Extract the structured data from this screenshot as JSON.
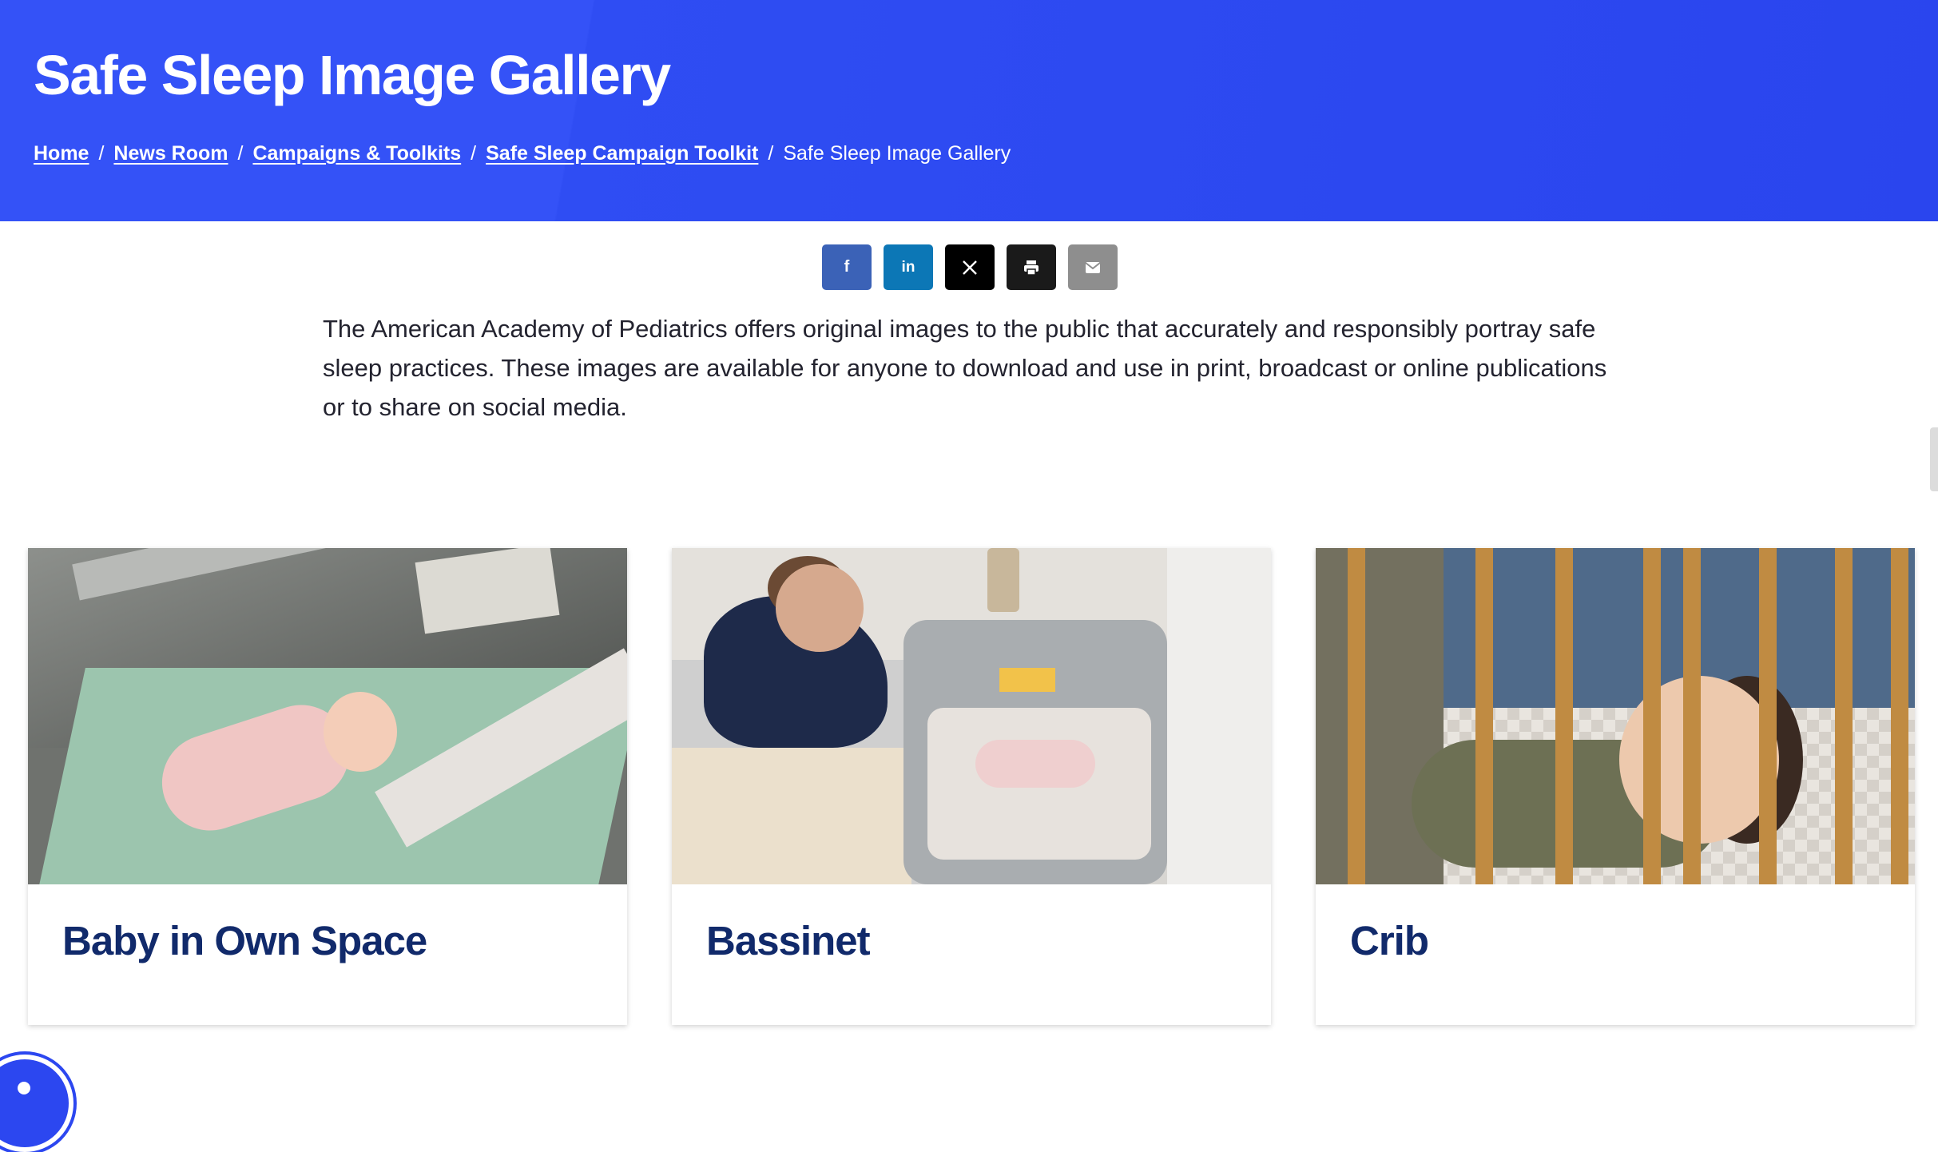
{
  "page": {
    "title": "Safe Sleep Image Gallery"
  },
  "breadcrumb": {
    "items": [
      {
        "label": "Home"
      },
      {
        "label": "News Room"
      },
      {
        "label": "Campaigns & Toolkits"
      },
      {
        "label": "Safe Sleep Campaign Toolkit"
      }
    ],
    "current": "Safe Sleep Image Gallery",
    "separator": "/"
  },
  "share": {
    "facebook": {
      "icon": "facebook-icon",
      "glyph": "f"
    },
    "linkedin": {
      "icon": "linkedin-icon",
      "glyph": "in"
    },
    "x": {
      "icon": "x-icon",
      "glyph": "𝕏"
    },
    "print": {
      "icon": "print-icon"
    },
    "email": {
      "icon": "email-icon"
    }
  },
  "intro": "The American Academy of Pediatrics offers original images to the public that accurately and responsibly portray safe sleep practices. These images are available for anyone to download and use in print, broadcast or online publications or to share on social media.",
  "cards": [
    {
      "title": "Baby in Own Space"
    },
    {
      "title": "Bassinet"
    },
    {
      "title": "Crib"
    }
  ],
  "colors": {
    "hero": "#3452f7",
    "card_title": "#112a6b",
    "facebook": "#3b62b7",
    "linkedin": "#0c77b6"
  },
  "accessibility_button": {
    "icon": "accessibility-icon"
  }
}
